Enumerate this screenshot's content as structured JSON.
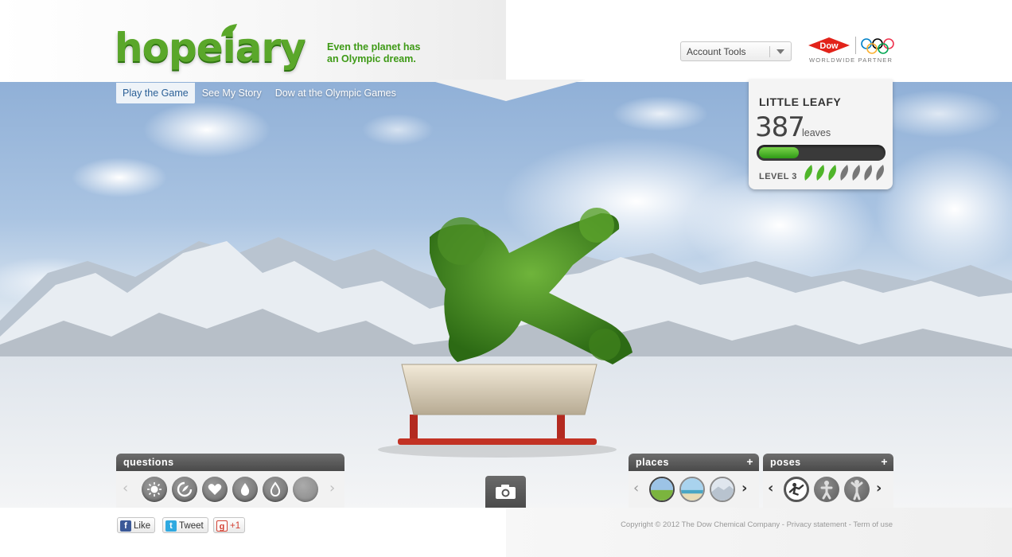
{
  "header": {
    "logo_text": "hopeiary",
    "tagline_line1": "Even the planet has",
    "tagline_line2": "an Olympic dream.",
    "account_tools": "Account Tools",
    "partner_brand": "Dow",
    "partner_text": "WORLDWIDE PARTNER"
  },
  "nav": {
    "items": [
      {
        "label": "Play the Game",
        "active": true
      },
      {
        "label": "See My Story",
        "active": false
      },
      {
        "label": "Dow at the Olympic Games",
        "active": false
      }
    ]
  },
  "card": {
    "name": "LITTLE LEAFY",
    "count": "387",
    "unit": "leaves",
    "progress": 0.32,
    "level_label": "LEVEL 3",
    "leaves_total": 7,
    "leaves_filled": 3
  },
  "panels": {
    "questions": {
      "title": "questions",
      "icons": [
        "sun-icon",
        "recycle-icon",
        "heart-icon",
        "water-drop-icon",
        "water-drop-icon",
        "disabled-icon"
      ]
    },
    "places": {
      "title": "places",
      "plus": "+",
      "items": [
        "grassland-place",
        "beach-place",
        "snow-place"
      ]
    },
    "poses": {
      "title": "poses",
      "plus": "+",
      "items": [
        "pose-1",
        "pose-2",
        "pose-3"
      ]
    }
  },
  "footer": {
    "like": "Like",
    "tweet": "Tweet",
    "gplus": "+1",
    "copyright": "Copyright © 2012 The Dow Chemical Company - Privacy statement - Term of use"
  },
  "colors": {
    "brand_green": "#5aa72a",
    "dow_red": "#e2231a",
    "nav_active_text": "#2a5f96"
  }
}
